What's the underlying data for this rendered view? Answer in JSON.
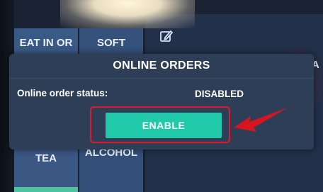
{
  "background": {
    "tiles": {
      "eat_in": "EAT IN OR",
      "soft": "SOFT",
      "tea": "TEA",
      "alcohol": "ALCOHOL"
    },
    "edge_letter": "A",
    "edit_icon": "pencil-square-icon"
  },
  "modal": {
    "title": "ONLINE ORDERS",
    "status_label": "Online order status:",
    "status_value": "DISABLED",
    "enable_button": "ENABLE"
  },
  "annotation": {
    "highlight_color": "#e0192b",
    "arrow_color": "#d8141f"
  },
  "colors": {
    "enable_button": "#1fc9aa",
    "modal_bg": "#2f3e57",
    "tile_bg": "#3a5a86"
  }
}
